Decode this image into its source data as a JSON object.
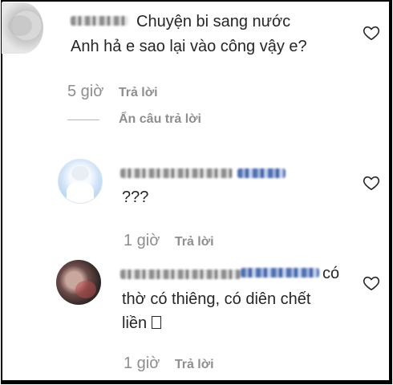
{
  "comments": [
    {
      "text_line_1": "Chuyện bi sang nước",
      "text_line_2": "Anh hả e sao lại vào công vậy e?",
      "time": "5 giờ",
      "reply_label": "Trả lời",
      "hide_replies_label": "Ẩn câu trả lời",
      "like_icon": "heart-outline-icon"
    },
    {
      "text_line_1": "???",
      "time": "1 giờ",
      "reply_label": "Trả lời",
      "like_icon": "heart-outline-icon"
    },
    {
      "text_line_1_tail": "có",
      "text_line_2": "thờ có thiêng, có diên chết",
      "text_line_3": "liền",
      "time": "1 giờ",
      "reply_label": "Trả lời",
      "like_icon": "heart-outline-icon"
    }
  ],
  "colors": {
    "text": "#262626",
    "muted": "#8e8e8e",
    "frame": "#000000"
  }
}
